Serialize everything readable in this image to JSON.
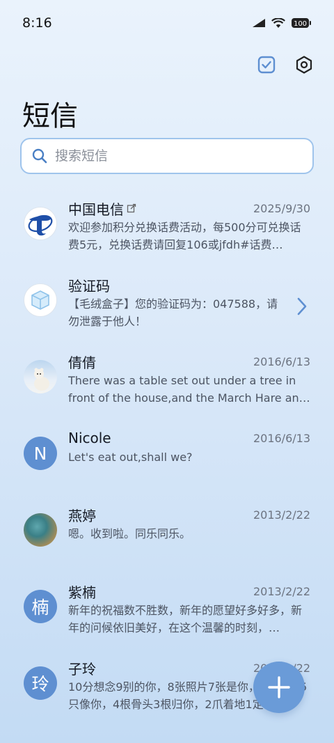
{
  "status_bar": {
    "time": "8:16",
    "battery": "100"
  },
  "header": {
    "title": "短信"
  },
  "search": {
    "placeholder": "搜索短信"
  },
  "conversations": [
    {
      "name": "中国电信",
      "date": "2025/9/30",
      "preview": "欢迎参加积分兑换话费活动，每500分可兑换话费5元，兑换话费请回复106或jfdh#话费…",
      "avatar_letter": ""
    },
    {
      "name": "验证码",
      "date": "",
      "preview": "【毛绒盒子】您的验证码为：047588，请勿泄露于他人！",
      "avatar_letter": ""
    },
    {
      "name": "倩倩",
      "date": "2016/6/13",
      "preview": "There was a table set out under a tree in front of the house,and the March Hare an…",
      "avatar_letter": ""
    },
    {
      "name": "Nicole",
      "date": "2016/6/13",
      "preview": "Let's eat out,shall we?",
      "avatar_letter": "N"
    },
    {
      "name": "燕婷",
      "date": "2013/2/22",
      "preview": "嗯。收到啦。同乐同乐。",
      "avatar_letter": ""
    },
    {
      "name": "紫楠",
      "date": "2013/2/22",
      "preview": "新年的祝福数不胜数，新年的愿望好多好多，新年的问候依旧美好，在这个温馨的时刻，…",
      "avatar_letter": "楠"
    },
    {
      "name": "子玲",
      "date": "2013/2/22",
      "preview": "10分想念9别的你，8张照片7张是你，6只小狗5只像你，4根骨头3根归你，2爪着地1定…",
      "avatar_letter": "玲"
    }
  ],
  "colors": {
    "accent": "#5e8fd1",
    "fab": "#6a9bd8",
    "search_border": "#9fc4ec"
  },
  "icons": {
    "top_actions": [
      "select-check-icon",
      "settings-hex-icon"
    ],
    "fab": "plus-icon"
  }
}
